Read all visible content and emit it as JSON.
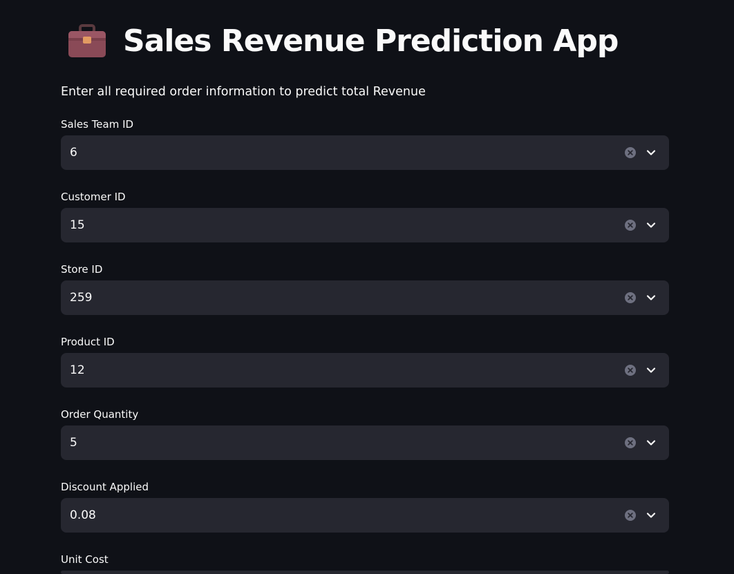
{
  "header": {
    "icon": "briefcase-icon",
    "title": "Sales Revenue Prediction App",
    "subtitle": "Enter all required order information to predict total Revenue"
  },
  "fields": [
    {
      "label": "Sales Team ID",
      "value": "6"
    },
    {
      "label": "Customer ID",
      "value": "15"
    },
    {
      "label": "Store ID",
      "value": "259"
    },
    {
      "label": "Product ID",
      "value": "12"
    },
    {
      "label": "Order Quantity",
      "value": "5"
    },
    {
      "label": "Discount Applied",
      "value": "0.08"
    },
    {
      "label": "Unit Cost",
      "value": ""
    }
  ],
  "colors": {
    "background": "#0f1117",
    "input_background": "#262730",
    "text": "#fafafa",
    "icon_muted": "#6e7080"
  }
}
